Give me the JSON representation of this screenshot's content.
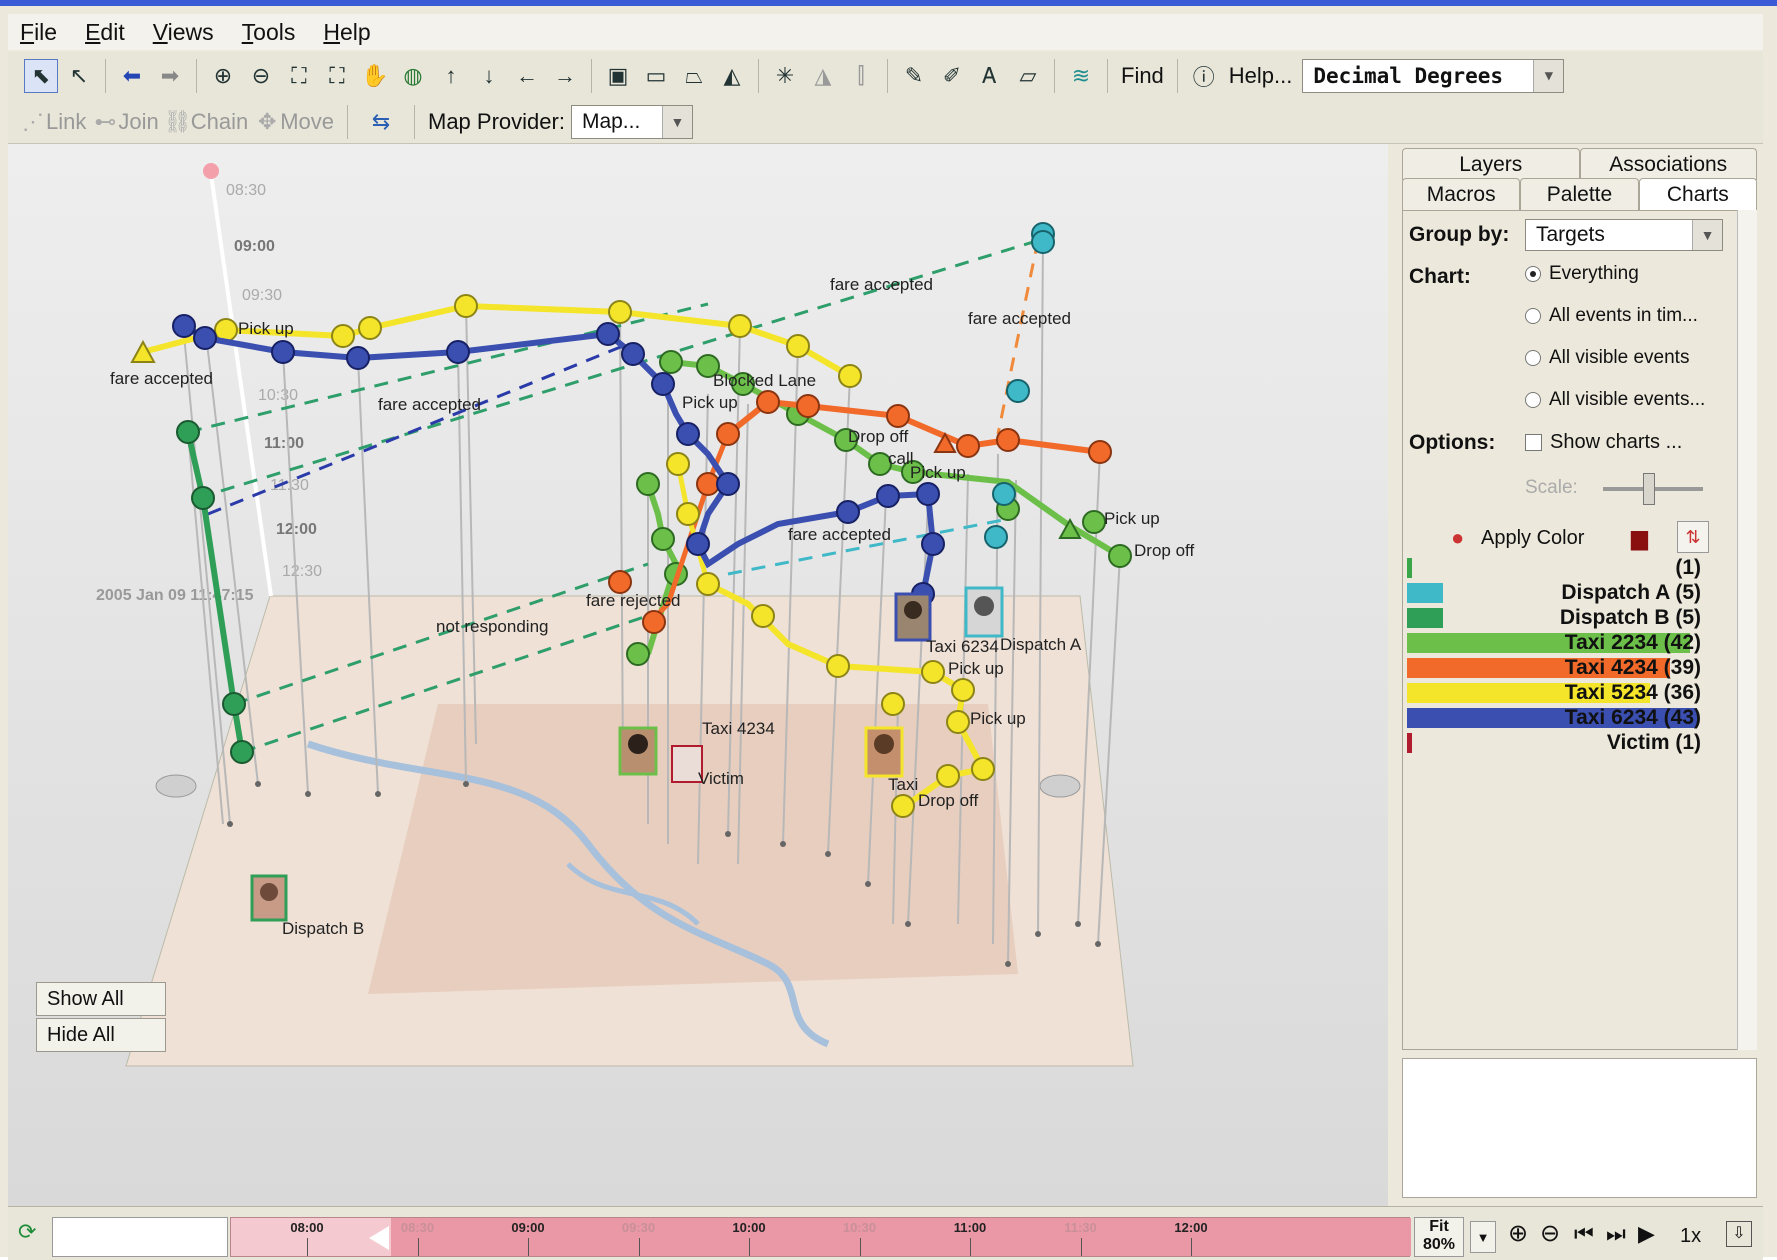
{
  "menu": [
    "File",
    "Edit",
    "Views",
    "Tools",
    "Help"
  ],
  "toolbar": {
    "find_label": "Find",
    "help_label": "Help...",
    "coord_format": "Decimal Degrees",
    "link_label": "Link",
    "join_label": "Join",
    "chain_label": "Chain",
    "move_label": "Move",
    "map_provider_label": "Map Provider:",
    "map_provider_value": "Map..."
  },
  "view": {
    "date_label": "2005 Jan 09 11:47:15",
    "time_axis": [
      "08:30",
      "09:00",
      "09:30",
      "10:30",
      "11:00",
      "11:30",
      "12:00",
      "12:30"
    ],
    "annotations": [
      "fare accepted",
      "fare accepted",
      "fare accepted",
      "fare accepted",
      "Pick up",
      "Pick up",
      "Drop off",
      "Drop off",
      "Pick up",
      "Pick up",
      "Blocked Lane",
      "not responding",
      "fare accepted",
      "Pick up",
      "Drop off",
      "Pick up",
      "call",
      "fare rejected"
    ],
    "entity_labels": [
      "Dispatch B",
      "Dispatch A",
      "Taxi 6234",
      "Taxi 4234",
      "Victim",
      "Taxi"
    ],
    "show_all": "Show All",
    "hide_all": "Hide All"
  },
  "panel": {
    "tabs_top": [
      "Layers",
      "Associations"
    ],
    "tabs_bottom": [
      "Macros",
      "Palette",
      "Charts"
    ],
    "group_by_label": "Group by:",
    "group_by_value": "Targets",
    "chart_label": "Chart:",
    "chart_options": [
      "Everything",
      "All events in tim...",
      "All visible events",
      "All visible events..."
    ],
    "options_label": "Options:",
    "show_charts": "Show charts ...",
    "scale_label": "Scale:",
    "apply_color": "Apply Color",
    "legend": [
      {
        "label": "(1)",
        "count": 1,
        "color": "#3aa64a"
      },
      {
        "label": "Dispatch A (5)",
        "count": 5,
        "color": "#3fb8c8"
      },
      {
        "label": "Dispatch B (5)",
        "count": 5,
        "color": "#2f9e57"
      },
      {
        "label": "Taxi 2234 (42)",
        "count": 42,
        "color": "#6cc04a"
      },
      {
        "label": "Taxi 4234 (39)",
        "count": 39,
        "color": "#f26a2a"
      },
      {
        "label": "Taxi 5234 (36)",
        "count": 36,
        "color": "#f4e52a"
      },
      {
        "label": "Taxi 6234 (43)",
        "count": 43,
        "color": "#3a4fb0"
      },
      {
        "label": "Victim (1)",
        "count": 1,
        "color": "#b01c2e"
      }
    ]
  },
  "timeline": {
    "ticks": [
      "08:00",
      "08:30",
      "09:00",
      "09:30",
      "10:00",
      "10:30",
      "11:00",
      "11:30",
      "12:00"
    ],
    "fit_label": "Fit",
    "zoom_label": "80%",
    "speed_label": "1x"
  }
}
